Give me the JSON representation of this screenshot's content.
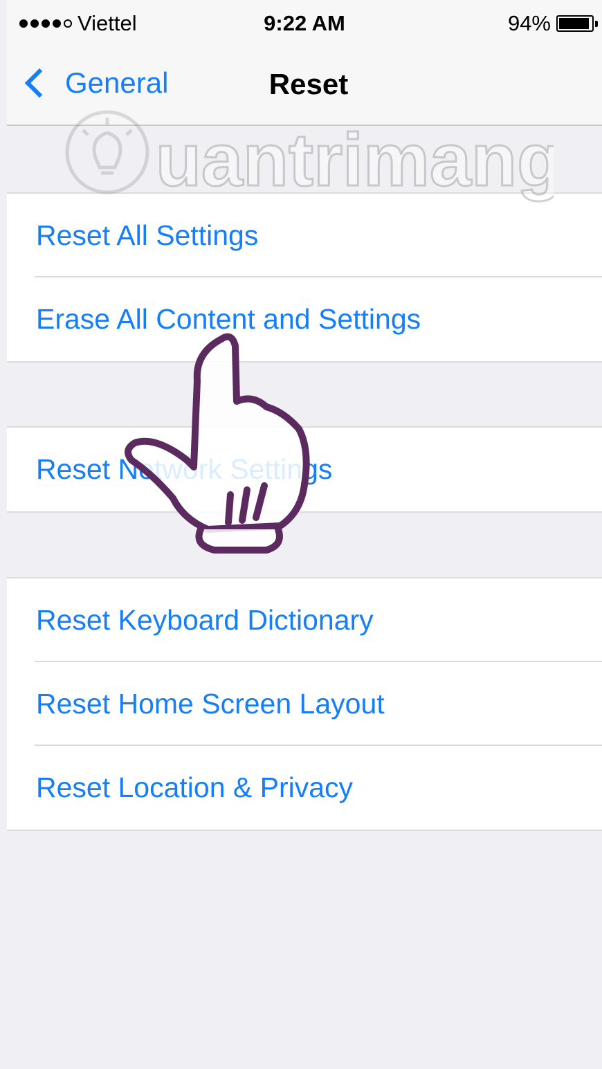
{
  "status_bar": {
    "carrier": "Viettel",
    "time": "9:22 AM",
    "battery": "94%",
    "battery_level": 0.94,
    "signal_bars": 4
  },
  "nav": {
    "back_label": "General",
    "title": "Reset"
  },
  "groups": [
    {
      "items": [
        "Reset All Settings",
        "Erase All Content and Settings"
      ]
    },
    {
      "items": [
        "Reset Network Settings"
      ]
    },
    {
      "items": [
        "Reset Keyboard Dictionary",
        "Reset Home Screen Layout",
        "Reset Location & Privacy"
      ]
    }
  ],
  "watermark": {
    "text": "uantrimang"
  },
  "colors": {
    "accent": "#147efb",
    "background": "#efeff4",
    "hand": "#5b2a5e"
  }
}
